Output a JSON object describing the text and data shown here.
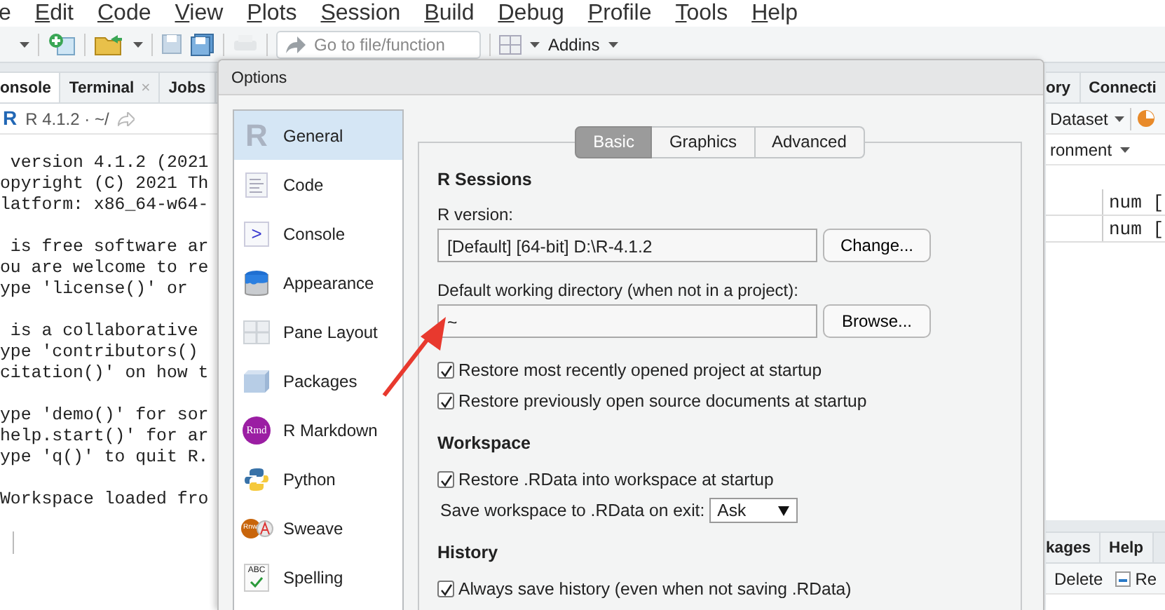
{
  "menu": [
    {
      "label": "e",
      "underlined": false
    },
    {
      "label": "Edit",
      "underlined": true
    },
    {
      "label": "Code",
      "underlined": true
    },
    {
      "label": "View",
      "underlined": true
    },
    {
      "label": "Plots",
      "underlined": true
    },
    {
      "label": "Session",
      "underlined": true
    },
    {
      "label": "Build",
      "underlined": true
    },
    {
      "label": "Debug",
      "underlined": true
    },
    {
      "label": "Profile",
      "underlined": true
    },
    {
      "label": "Tools",
      "underlined": true
    },
    {
      "label": "Help",
      "underlined": true
    }
  ],
  "toolbar": {
    "goto_placeholder": "Go to file/function",
    "addins": "Addins"
  },
  "console_pane": {
    "tabs": [
      {
        "label": "onsole",
        "selected": true
      },
      {
        "label": "Terminal",
        "selected": false,
        "close": "×"
      },
      {
        "label": "Jobs",
        "selected": false
      }
    ],
    "logo_text": "R",
    "info": "R 4.1.2 · ~/",
    "output": [
      [
        " version 4.1.2 (2021",
        "opyright (C) 2021 Th",
        "latform: x86_64-w64-"
      ],
      [
        " is free software ar",
        "ou are welcome to re",
        "ype 'license()' or"
      ],
      [
        " is a collaborative",
        "ype 'contributors()",
        "citation()' on how t"
      ],
      [
        "ype 'demo()' for sor",
        "help.start()' for ar",
        "ype 'q()' to quit R."
      ],
      [
        "Workspace loaded fro"
      ]
    ]
  },
  "environment_pane": {
    "tabs": [
      {
        "label": "ory",
        "selected": false
      },
      {
        "label": "Connecti",
        "selected": false
      }
    ],
    "import_label": "Dataset",
    "scope_label": "ronment",
    "rows": [
      {
        "column_2": "num ["
      },
      {
        "column_2": "num ["
      }
    ]
  },
  "files_pane": {
    "tabs": [
      {
        "label": "kages",
        "selected": false
      },
      {
        "label": "Help",
        "selected": false
      }
    ],
    "actions": [
      "Delete",
      "Re"
    ]
  },
  "dialog": {
    "title": "Options",
    "categories": [
      {
        "label": "General",
        "selected": true,
        "icon_text": "R"
      },
      {
        "label": "Code",
        "selected": false
      },
      {
        "label": "Console",
        "selected": false,
        "icon_text": ">"
      },
      {
        "label": "Appearance",
        "selected": false
      },
      {
        "label": "Pane Layout",
        "selected": false
      },
      {
        "label": "Packages",
        "selected": false
      },
      {
        "label": "R Markdown",
        "selected": false,
        "icon_text": "Rmd"
      },
      {
        "label": "Python",
        "selected": false
      },
      {
        "label": "Sweave",
        "selected": false,
        "icon_text": "Rnw"
      },
      {
        "label": "Spelling",
        "selected": false,
        "icon_text": "ABC"
      }
    ],
    "tabs": [
      {
        "label": "Basic",
        "selected": true
      },
      {
        "label": "Graphics",
        "selected": false
      },
      {
        "label": "Advanced",
        "selected": false
      }
    ],
    "sections": [
      {
        "heading": "R Sessions",
        "items": [
          {
            "kind": "field",
            "label": "R version:",
            "value": "[Default] [64-bit] D:\\R-4.1.2",
            "button": "Change..."
          },
          {
            "kind": "field",
            "label": "Default working directory (when not in a project):",
            "value": "~",
            "button": "Browse..."
          },
          {
            "kind": "checkbox",
            "label": "Restore most recently opened project at startup",
            "checked": true
          },
          {
            "kind": "checkbox",
            "label": "Restore previously open source documents at startup",
            "checked": true
          }
        ]
      },
      {
        "heading": "Workspace",
        "items": [
          {
            "kind": "checkbox",
            "label": "Restore .RData into workspace at startup",
            "checked": true
          },
          {
            "kind": "select",
            "label": "Save workspace to .RData on exit:",
            "value": "Ask"
          }
        ]
      },
      {
        "heading": "History",
        "items": [
          {
            "kind": "checkbox",
            "label": "Always save history (even when not saving .RData)",
            "checked": true
          }
        ]
      }
    ]
  }
}
